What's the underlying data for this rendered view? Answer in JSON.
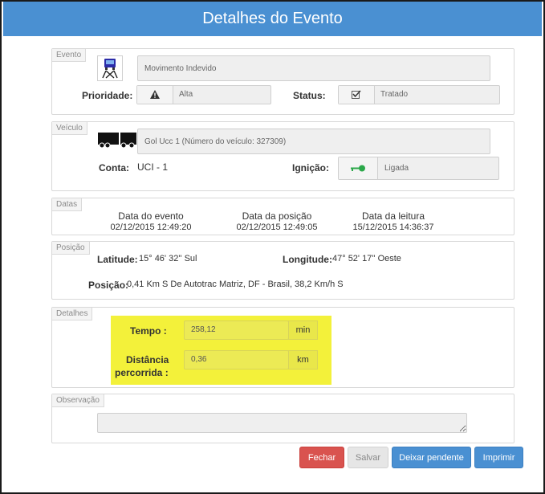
{
  "window": {
    "title": "Detalhes do Evento"
  },
  "evento": {
    "legend": "Evento",
    "name": "Movimento Indevido",
    "prioridade_label": "Prioridade:",
    "prioridade_value": "Alta",
    "status_label": "Status:",
    "status_value": "Tratado",
    "icons": [
      "vehicle-event-icon",
      "warning-triangle-icon",
      "checkbox-icon"
    ]
  },
  "veiculo": {
    "legend": "Veículo",
    "name": "Gol Ucc 1 (Número do veículo: 327309)",
    "conta_label": "Conta:",
    "conta_value": "UCI - 1",
    "ignicao_label": "Ignição:",
    "ignicao_value": "Ligada",
    "icons": [
      "truck-icon",
      "key-icon"
    ]
  },
  "datas": {
    "legend": "Datas",
    "evento_label": "Data do evento",
    "evento_value": "02/12/2015 12:49:20",
    "posicao_label": "Data da posição",
    "posicao_value": "02/12/2015 12:49:05",
    "leitura_label": "Data da leitura",
    "leitura_value": "15/12/2015 14:36:37"
  },
  "posicao": {
    "legend": "Posição",
    "latitude_label": "Latitude:",
    "latitude_value": "15° 46' 32'' Sul",
    "longitude_label": "Longitude:",
    "longitude_value": "47° 52' 17'' Oeste",
    "posicao_label": "Posição:",
    "posicao_value": "0,41 Km S De Autotrac Matriz, DF - Brasil, 38,2 Km/h S"
  },
  "detalhes": {
    "legend": "Detalhes",
    "tempo_label": "Tempo :",
    "tempo_value": "258,12",
    "tempo_unit": "min",
    "distancia_label_1": "Distância",
    "distancia_label_2": "percorrida :",
    "distancia_value": "0,36",
    "distancia_unit": "km",
    "highlight_color": "#f3f13a"
  },
  "observacao": {
    "legend": "Observação",
    "value": ""
  },
  "buttons": {
    "fechar": "Fechar",
    "salvar": "Salvar",
    "pendente": "Deixar pendente",
    "imprimir": "Imprimir"
  },
  "colors": {
    "header": "#4a90d2",
    "fechar": "#d9534f",
    "primary": "#4a90d2",
    "disabled": "#e6e6e6"
  }
}
